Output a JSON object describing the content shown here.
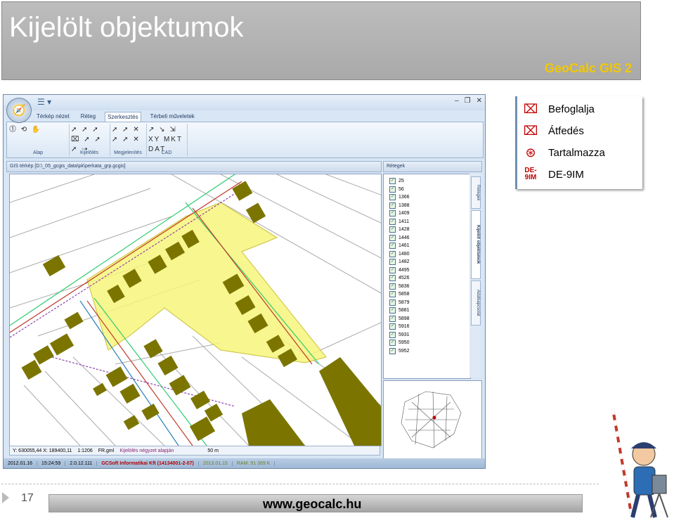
{
  "slide": {
    "title": "Kijelölt objektumok",
    "brand": "GeoCalc GIS 2",
    "number": "17",
    "url": "www.geocalc.hu"
  },
  "app": {
    "quick_access": "☰ ▾",
    "window_controls": [
      "–",
      "❐",
      "✕"
    ],
    "tabs": [
      "Térkép nézet",
      "Réteg",
      "Szerkesztés",
      "Térbeli műveletek"
    ],
    "active_tab": "Szerkesztés",
    "ribbon_groups": [
      {
        "label": "Alap",
        "icons": "⓵ ⟲ ✋"
      },
      {
        "label": "Kijelölés",
        "icons": "➚ ➚ ➚ ⌧ ➚ ➚ ➚ ⇢"
      },
      {
        "label": "Megjelenítés",
        "icons": "➚ ➚ ✕ ➚ ➚ ✕"
      },
      {
        "label": "CAD",
        "icons": "↗ ↘ ⇲ XY MKT DAT"
      }
    ],
    "map_panel_title": "GIS térkép [D:\\_05_gcgis_data\\pk\\perkata_grp.gcgis]",
    "layers_panel_title": "Rétegek",
    "layers": [
      "25",
      "56",
      "1366",
      "1388",
      "1409",
      "1411",
      "1428",
      "1446",
      "1461",
      "1480",
      "1482",
      "4495",
      "4526",
      "5836",
      "5858",
      "5879",
      "5881",
      "5898",
      "5916",
      "5931",
      "5950",
      "5952"
    ],
    "vertical_tabs": [
      "Rétegek",
      "Kijelölt objektumok",
      "Adatkapcsolat"
    ],
    "active_vertical_tab": "Kijelölt objektumok",
    "coordinate_bar": {
      "coords": "Y: 630055,44  X: 189400,11",
      "scale": "1:1206",
      "file": "FR.gml",
      "mode": "Kijelölés négyzet alapján",
      "scalebar": "50 m"
    },
    "status_bar": {
      "date": "2012.01.16",
      "time": "15:24:59",
      "version": "2.0.12.111",
      "company": "GCSoft Informatikai Kft (14134001-2-07)",
      "date2": "2013.01.15",
      "ram": "RAM: 91 369 K"
    }
  },
  "selection_menu": {
    "items": [
      {
        "label": "Befoglalja",
        "icon": "contain-select-icon"
      },
      {
        "label": "Átfedés",
        "icon": "overlap-select-icon"
      },
      {
        "label": "Tartalmazza",
        "icon": "within-select-icon"
      },
      {
        "label": "DE-9IM",
        "icon": "de9im-icon",
        "icon_text_top": "DE-",
        "icon_text_bottom": "9IM"
      }
    ]
  },
  "colors": {
    "brand": "#f2c800",
    "header_bg": "#b3b3b3",
    "selection": "#f7f57a",
    "building": "#7b7500",
    "menu_icon": "#c00000"
  }
}
